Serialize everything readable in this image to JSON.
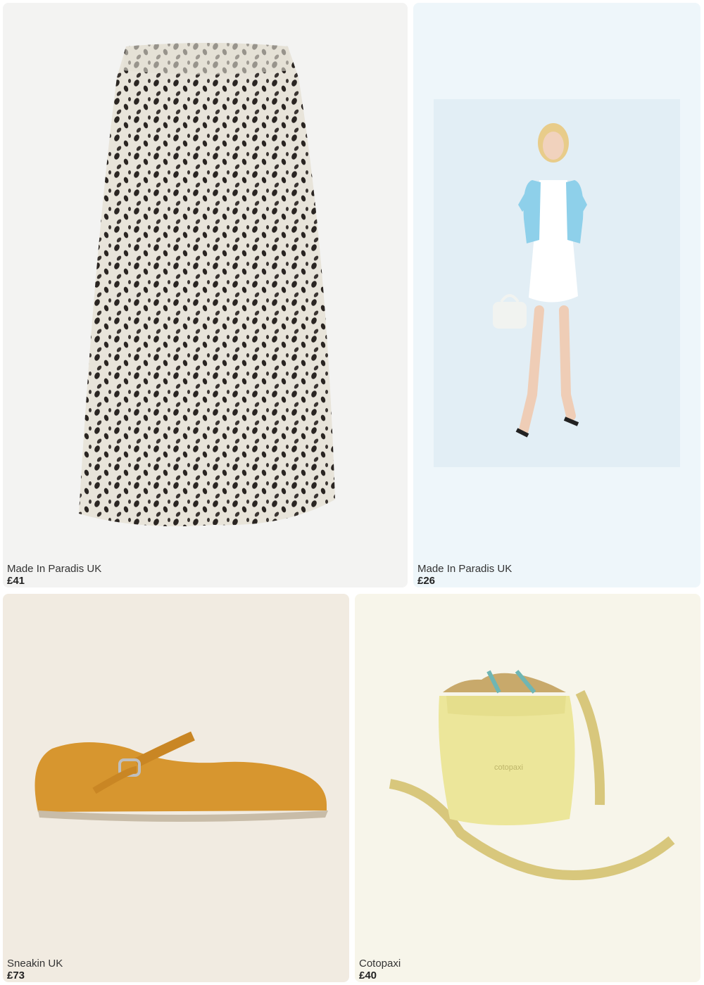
{
  "products": [
    {
      "brand": "Made In Paradis UK",
      "price": "£41",
      "image": "dalmatian-print-midi-skirt"
    },
    {
      "brand": "Made In Paradis UK",
      "price": "£26",
      "image": "model-blue-cardigan-white-dress"
    },
    {
      "brand": "Sneakin UK",
      "price": "£73",
      "image": "mustard-mary-jane-shoe"
    },
    {
      "brand": "Cotopaxi",
      "price": "£40",
      "image": "yellow-drawstring-crossbody-bag"
    }
  ],
  "colors": {
    "card1_bg": "#f3f3f2",
    "card2_bg": "#eef6fa",
    "card3_bg": "#f1ebe1",
    "card4_bg": "#f7f5ea"
  }
}
